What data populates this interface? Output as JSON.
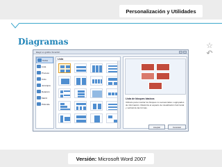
{
  "header": {
    "title": "Personalización y Utilidades"
  },
  "slide": {
    "heading": "Diagramas"
  },
  "side_icons": [
    "star-outline-icon",
    "undo-arrow-icon"
  ],
  "dialog": {
    "title": "Elegir un gráfico SmartArt",
    "categories": [
      {
        "label": "Todos",
        "selected": true
      },
      {
        "label": "Lista",
        "selected": false
      },
      {
        "label": "Proceso",
        "selected": false
      },
      {
        "label": "Ciclo",
        "selected": false
      },
      {
        "label": "Jerarquía",
        "selected": false
      },
      {
        "label": "Relación",
        "selected": false
      },
      {
        "label": "Matriz",
        "selected": false
      },
      {
        "label": "Pirámide",
        "selected": false
      }
    ],
    "list_header": "Lista",
    "preview_title": "Lista de bloques básicos",
    "preview_description": "Utilícelo para mostrar los bloques no secuenciales o agrupados de información. Maximiza el espacio de visualización horizontal y vertical de las formas.",
    "buttons": {
      "ok": "Aceptar",
      "cancel": "Cancelar"
    }
  },
  "footer": {
    "version_label": "Versión:",
    "version_value": "Microsoft Word 2007"
  },
  "colors": {
    "accent": "#1f84b8",
    "line": "#3aa7cc",
    "preview_shape": "#c24b3c",
    "band": "#ececec"
  }
}
